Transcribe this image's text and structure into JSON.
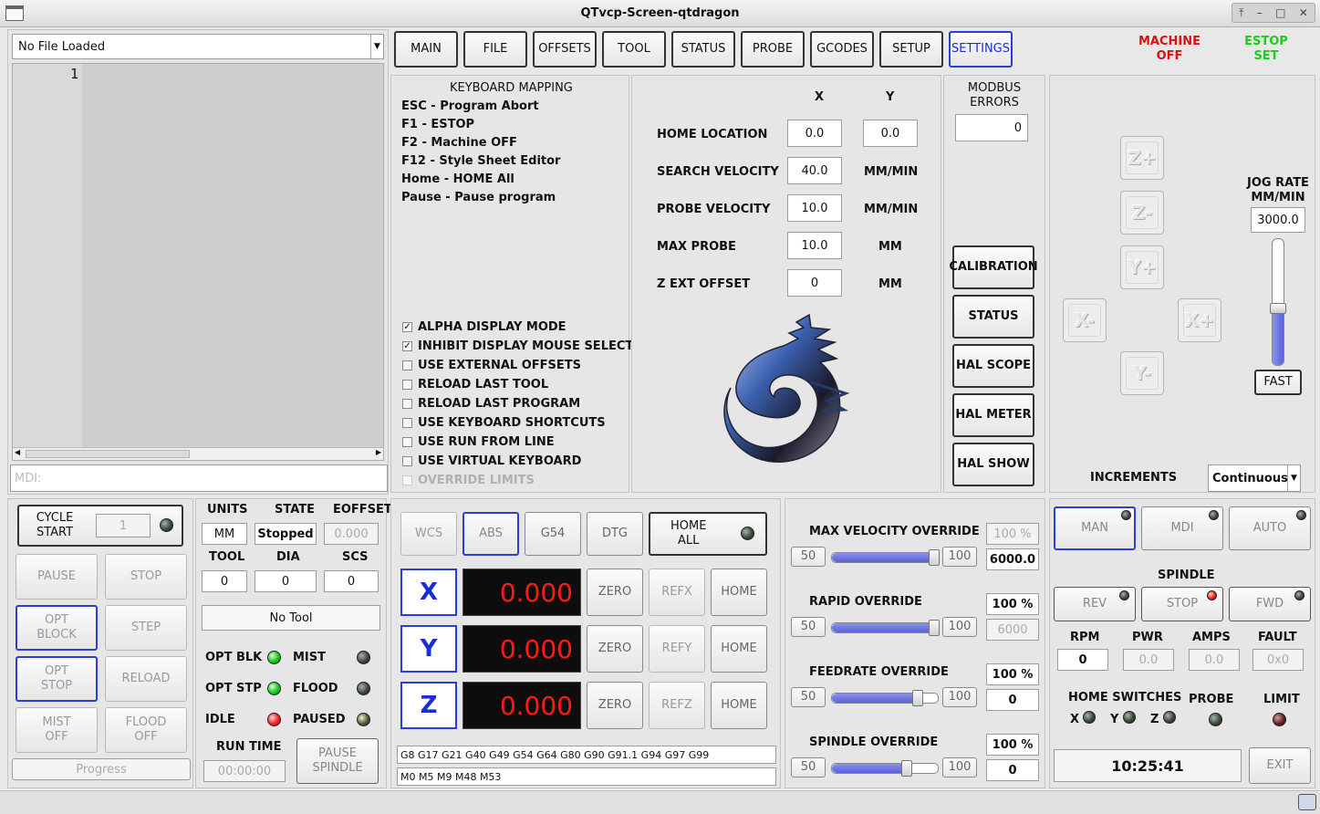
{
  "window": {
    "title": "QTvcp-Screen-qtdragon"
  },
  "file": {
    "name": "No File Loaded",
    "line_number": "1",
    "mdi_placeholder": "MDI:"
  },
  "tabs": [
    "MAIN",
    "FILE",
    "OFFSETS",
    "TOOL",
    "STATUS",
    "PROBE",
    "GCODES",
    "SETUP",
    "SETTINGS"
  ],
  "machine_status": {
    "machine": "MACHINE\nOFF",
    "estop": "ESTOP\nSET",
    "machine_color": "#e01010",
    "estop_color": "#18d018"
  },
  "keyboard": {
    "title": "KEYBOARD MAPPING",
    "items": [
      "ESC - Program Abort",
      "F1 - ESTOP",
      "F2 - Machine OFF",
      "F12 - Style Sheet Editor",
      "Home - HOME All",
      "Pause - Pause program"
    ]
  },
  "options": [
    {
      "label": "ALPHA DISPLAY MODE",
      "checked": true
    },
    {
      "label": "INHIBIT DISPLAY MOUSE SELECT",
      "checked": true
    },
    {
      "label": "USE EXTERNAL OFFSETS",
      "checked": false
    },
    {
      "label": "RELOAD LAST TOOL",
      "checked": false
    },
    {
      "label": "RELOAD LAST PROGRAM",
      "checked": false
    },
    {
      "label": "USE KEYBOARD SHORTCUTS",
      "checked": false
    },
    {
      "label": "USE RUN FROM LINE",
      "checked": false
    },
    {
      "label": "USE VIRTUAL KEYBOARD",
      "checked": false
    },
    {
      "label": "OVERRIDE LIMITS",
      "checked": false,
      "disabled": true
    }
  ],
  "probe_settings": {
    "col_x": "X",
    "col_y": "Y",
    "rows": [
      {
        "label": "HOME LOCATION",
        "x": "0.0",
        "y": "0.0",
        "unit": ""
      },
      {
        "label": "SEARCH VELOCITY",
        "x": "40.0",
        "unit": "MM/MIN"
      },
      {
        "label": "PROBE VELOCITY",
        "x": "10.0",
        "unit": "MM/MIN"
      },
      {
        "label": "MAX PROBE",
        "x": "10.0",
        "unit": "MM"
      },
      {
        "label": "Z EXT OFFSET",
        "x": "0",
        "unit": "MM"
      }
    ]
  },
  "modbus": {
    "title": "MODBUS\nERRORS",
    "value": "0"
  },
  "tool_buttons": [
    "CALIBRATION",
    "STATUS",
    "HAL SCOPE",
    "HAL METER",
    "HAL SHOW"
  ],
  "jog": {
    "rate_label": "JOG RATE\nMM/MIN",
    "rate": "3000.0",
    "fast": "FAST",
    "increments_label": "INCREMENTS",
    "increment": "Continuous",
    "buttons": [
      "Z+",
      "Z-",
      "Y+",
      "X-",
      "X+",
      "Y-"
    ],
    "rate_level": 0.45
  },
  "cycle": {
    "cycle_start": "CYCLE\nSTART",
    "line": "1",
    "buttons": [
      "PAUSE",
      "STOP",
      "OPT\nBLOCK",
      "STEP",
      "OPT\nSTOP",
      "RELOAD",
      "MIST\nOFF",
      "FLOOD\nOFF"
    ],
    "progress": "Progress"
  },
  "state": {
    "units_label": "UNITS",
    "state_label": "STATE",
    "eoffset_label": "EOFFSET",
    "units": "MM",
    "state": "Stopped",
    "eoffset": "0.000",
    "tool_label": "TOOL",
    "dia_label": "DIA",
    "scs_label": "SCS",
    "tool": "0",
    "dia": "0",
    "scs": "0",
    "tool_desc": "No Tool",
    "indicators": [
      [
        "OPT BLK",
        "MIST"
      ],
      [
        "OPT STP",
        "FLOOD"
      ],
      [
        "IDLE",
        "PAUSED"
      ]
    ],
    "run_time_label": "RUN TIME",
    "run_time": "00:00:00",
    "pause_spindle": "PAUSE\nSPINDLE"
  },
  "dro": {
    "wcs": "WCS",
    "abs": "ABS",
    "g54": "G54",
    "dtg": "DTG",
    "home_all": "HOME\nALL",
    "axes": [
      {
        "name": "X",
        "value": "0.000",
        "ref": "REFX"
      },
      {
        "name": "Y",
        "value": "0.000",
        "ref": "REFY"
      },
      {
        "name": "Z",
        "value": "0.000",
        "ref": "REFZ"
      }
    ],
    "zero": "ZERO",
    "home": "HOME",
    "gcodes": "G8 G17 G21 G40 G49 G54 G64 G80 G90 G91.1 G94 G97 G99",
    "mcodes": "M0 M5 M9 M48 M53"
  },
  "overrides": [
    {
      "label": "MAX VELOCITY OVERRIDE",
      "min": "50",
      "max": "100",
      "percent": "100 %",
      "value": "6000.0",
      "level": 1.0
    },
    {
      "label": "RAPID OVERRIDE",
      "min": "50",
      "max": "100",
      "percent": "100 %",
      "value": "6000",
      "level": 1.0
    },
    {
      "label": "FEEDRATE OVERRIDE",
      "min": "50",
      "max": "100",
      "percent": "100 %",
      "value": "0",
      "level": 0.83
    },
    {
      "label": "SPINDLE OVERRIDE",
      "min": "50",
      "max": "100",
      "percent": "100 %",
      "value": "0",
      "level": 0.72
    }
  ],
  "modes": [
    "MAN",
    "MDI",
    "AUTO"
  ],
  "spindle": {
    "title": "SPINDLE",
    "buttons": [
      "REV",
      "STOP",
      "FWD"
    ],
    "rpm_label": "RPM",
    "pwr_label": "PWR",
    "amps_label": "AMPS",
    "fault_label": "FAULT",
    "rpm": "0",
    "pwr": "0.0",
    "amps": "0.0",
    "fault": "0x0",
    "home_switches": "HOME SWITCHES",
    "probe": "PROBE",
    "limit": "LIMIT",
    "axes": [
      "X",
      "Y",
      "Z"
    ]
  },
  "clock": "10:25:41",
  "exit": "EXIT"
}
